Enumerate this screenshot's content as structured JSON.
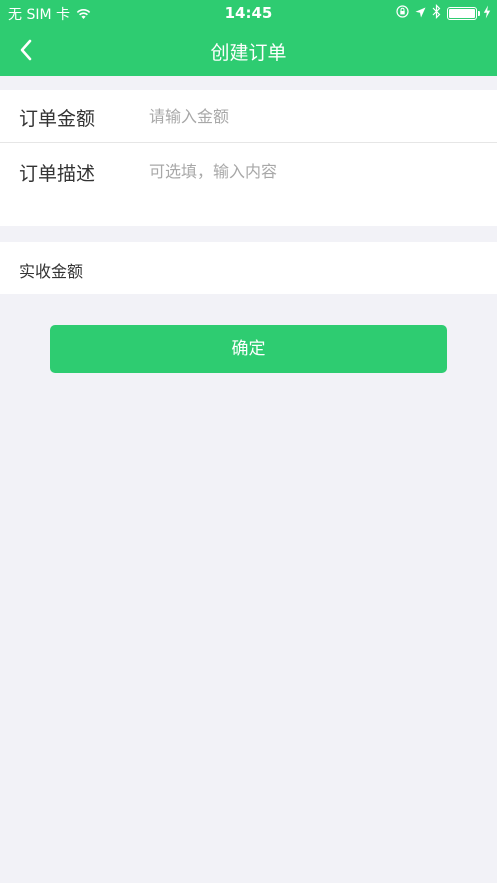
{
  "status_bar": {
    "carrier": "无 SIM 卡",
    "time": "14:45",
    "icons": [
      "wifi-icon",
      "orientation-lock-icon",
      "location-icon",
      "bluetooth-icon",
      "battery-icon",
      "charging-icon"
    ],
    "battery_level": 1.0
  },
  "nav": {
    "back_icon": "chevron-left-icon",
    "title": "创建订单"
  },
  "form": {
    "amount": {
      "label": "订单金额",
      "value": "",
      "placeholder": "请输入金额"
    },
    "description": {
      "label": "订单描述",
      "value": "",
      "placeholder": "可选填，输入内容"
    }
  },
  "received": {
    "label": "实收金额"
  },
  "actions": {
    "confirm_label": "确定"
  },
  "colors": {
    "accent": "#2ecc71",
    "background": "#f2f2f7",
    "placeholder": "#a8a8a8",
    "text": "#333333"
  }
}
